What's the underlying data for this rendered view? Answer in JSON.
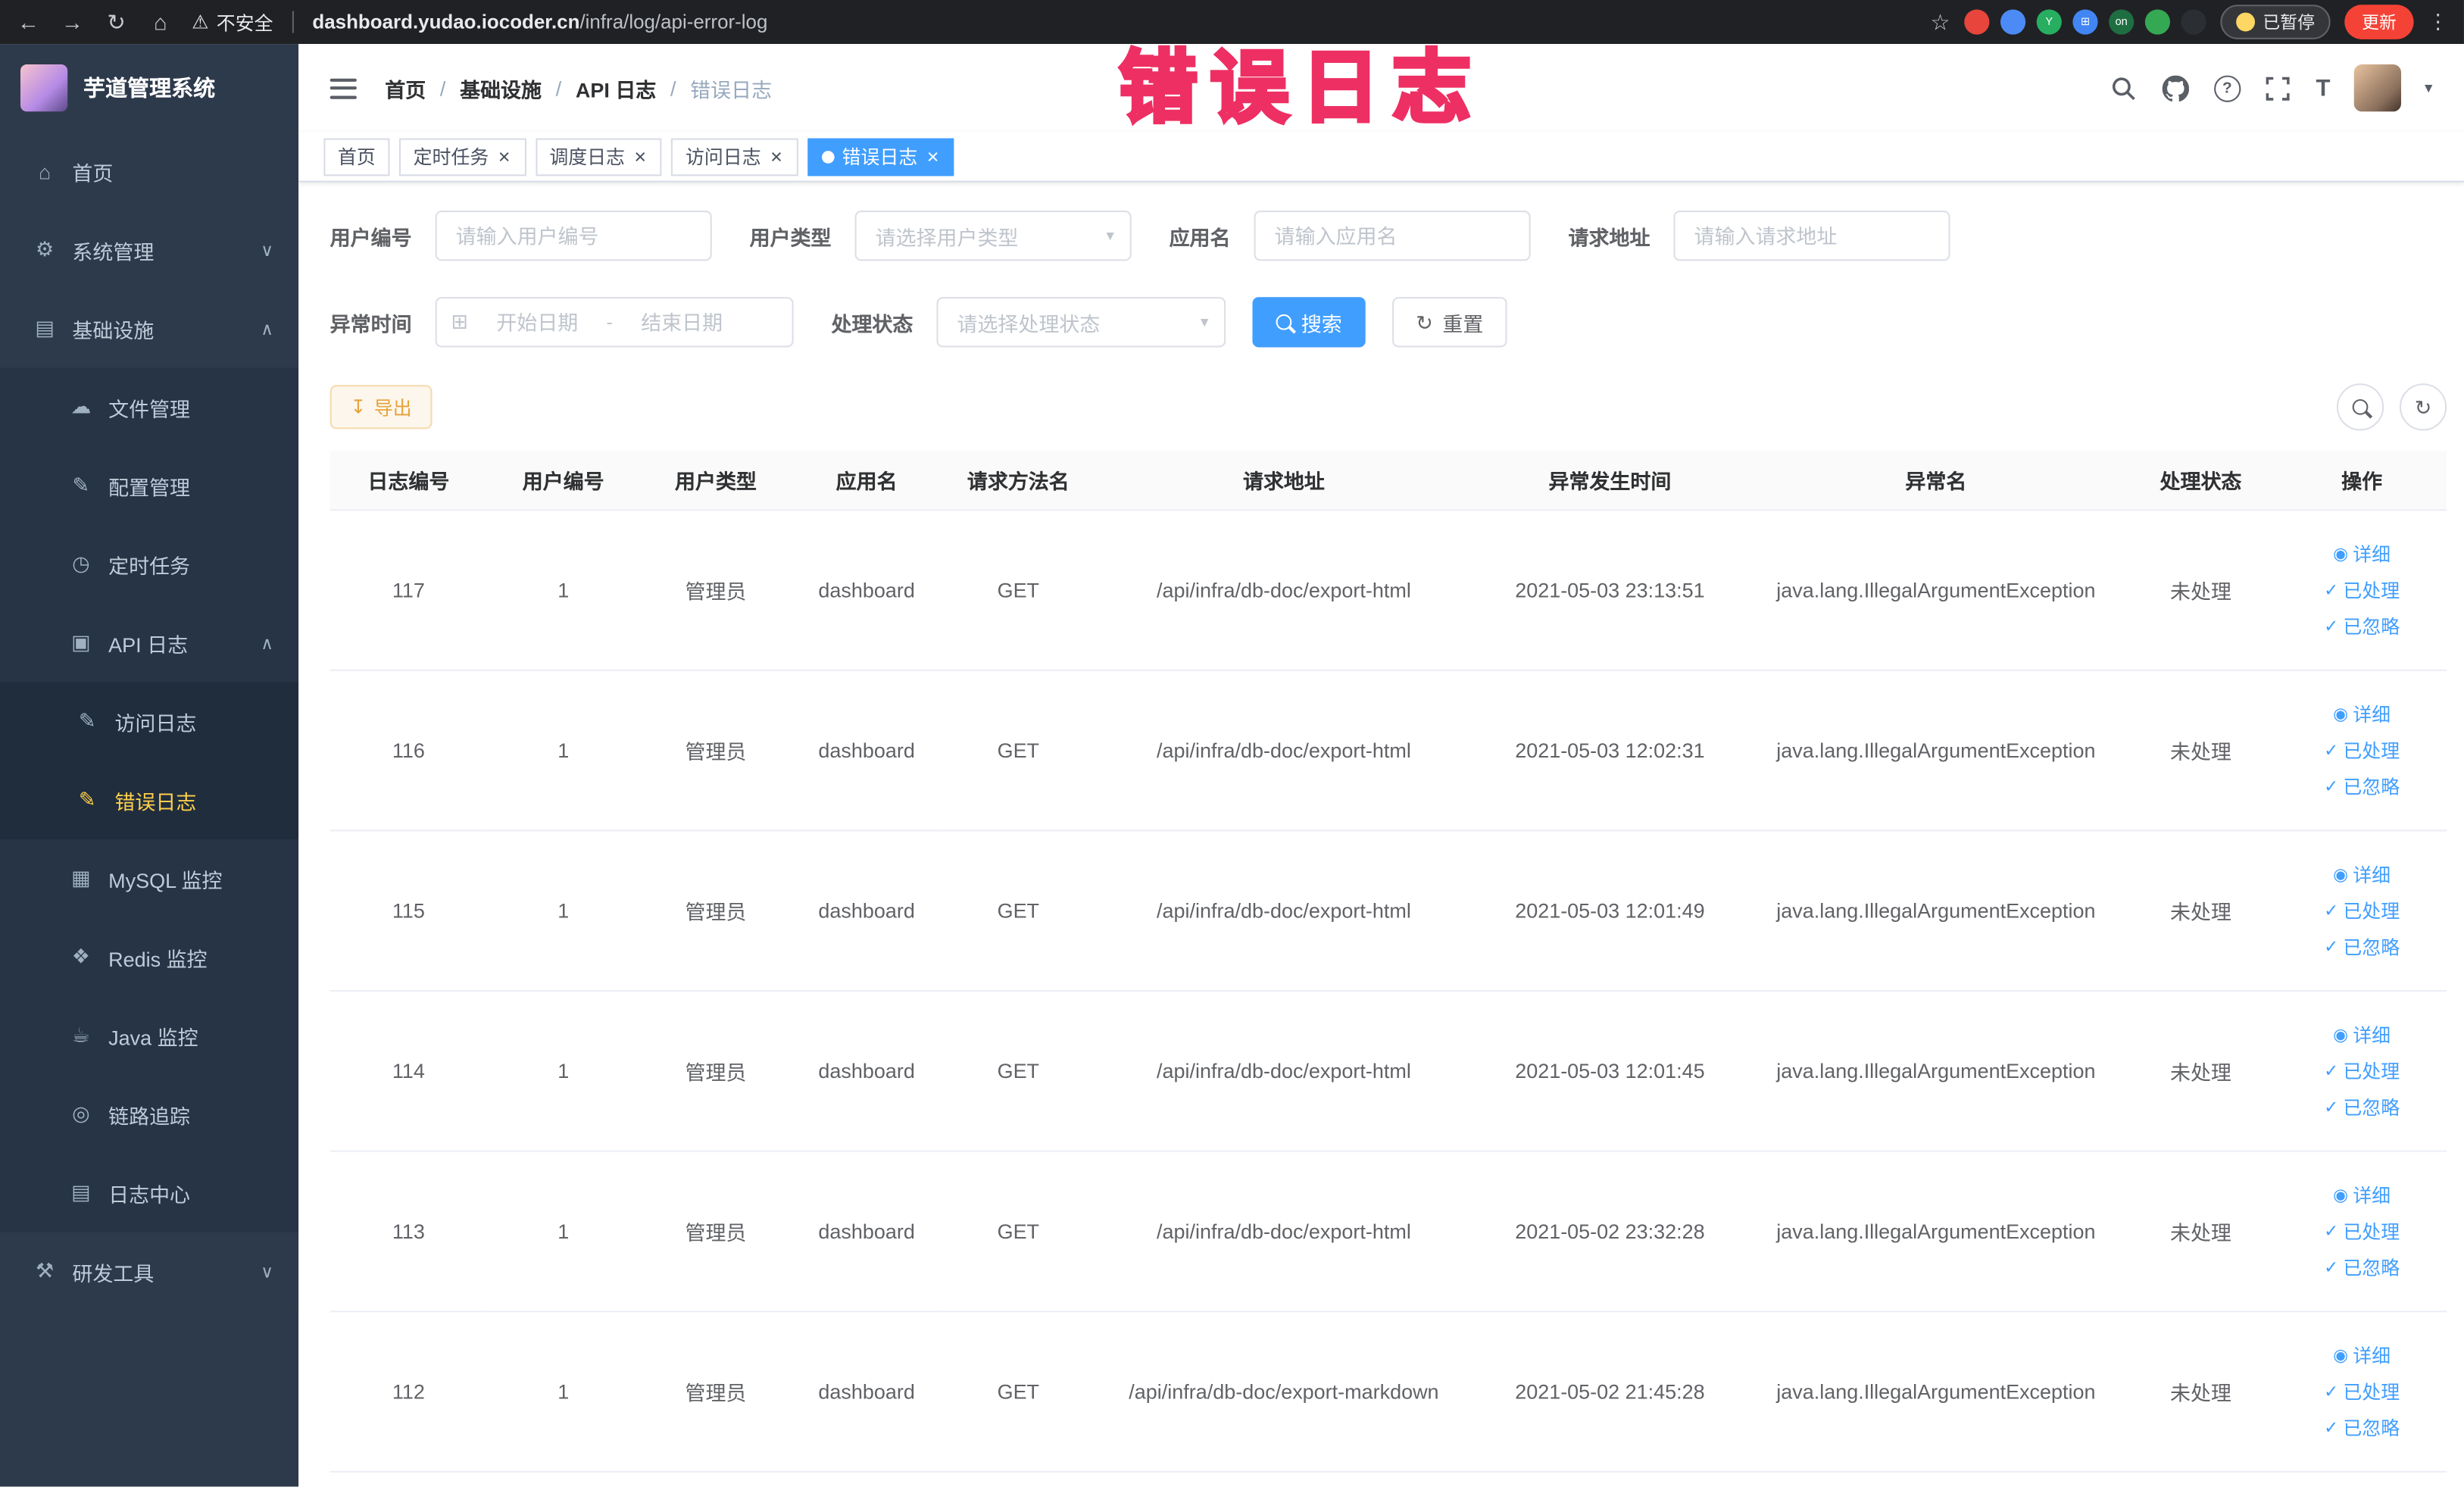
{
  "icon_glyphs": {
    "home": "⌂",
    "gear": "⚙",
    "infra": "▤",
    "file": "☁",
    "config": "✎",
    "timer": "◷",
    "api-log": "▣",
    "doc": "✎",
    "mysql": "▦",
    "redis": "❖",
    "java": "☕",
    "trace": "◎",
    "log-center": "▤",
    "tools": "⚒",
    "arrow-up": "∧",
    "arrow-down": "∨",
    "caret-down": "▾",
    "back": "←",
    "forward": "→",
    "reload": "↻",
    "warning": "⚠",
    "star": "☆",
    "kebab": "⋮",
    "eye": "◉",
    "check": "✓",
    "download": "↧",
    "refresh": "↻",
    "calendar": "⊞",
    "font-size": "T",
    "question": "?"
  },
  "browser": {
    "security_label": "不安全",
    "url_domain": "dashboard.yudao.iocoder.cn",
    "url_path": "/infra/log/api-error-log",
    "extensions": [
      {
        "color": "#e8453c",
        "label": ""
      },
      {
        "color": "#4c8bf5",
        "label": ""
      },
      {
        "color": "#27ae60",
        "label": "Y"
      },
      {
        "color": "#4285f4",
        "label": "⊞"
      },
      {
        "color": "#1e6e42",
        "label": "on"
      },
      {
        "color": "#34a853",
        "label": ""
      },
      {
        "color": "#2b2f33",
        "label": ""
      }
    ],
    "paused_label": "已暂停",
    "update_label": "更新"
  },
  "overlay": {
    "title": "错误日志"
  },
  "sidebar": {
    "logo_title": "芋道管理系统",
    "items": [
      {
        "label": "首页",
        "icon": "home",
        "depth": 0
      },
      {
        "label": "系统管理",
        "icon": "gear",
        "depth": 0,
        "arrow": "down"
      },
      {
        "label": "基础设施",
        "icon": "infra",
        "depth": 0,
        "arrow": "up"
      },
      {
        "label": "文件管理",
        "icon": "file",
        "depth": 1
      },
      {
        "label": "配置管理",
        "icon": "config",
        "depth": 1
      },
      {
        "label": "定时任务",
        "icon": "timer",
        "depth": 1
      },
      {
        "label": "API 日志",
        "icon": "api-log",
        "depth": 1,
        "arrow": "up"
      },
      {
        "label": "访问日志",
        "icon": "doc",
        "depth": 2
      },
      {
        "label": "错误日志",
        "icon": "doc",
        "depth": 2,
        "active": true
      },
      {
        "label": "MySQL 监控",
        "icon": "mysql",
        "depth": 1
      },
      {
        "label": "Redis 监控",
        "icon": "redis",
        "depth": 1
      },
      {
        "label": "Java 监控",
        "icon": "java",
        "depth": 1
      },
      {
        "label": "链路追踪",
        "icon": "trace",
        "depth": 1
      },
      {
        "label": "日志中心",
        "icon": "log-center",
        "depth": 1
      },
      {
        "label": "研发工具",
        "icon": "tools",
        "depth": 0,
        "arrow": "down"
      }
    ]
  },
  "header": {
    "separator": "/",
    "breadcrumb": [
      {
        "label": "首页"
      },
      {
        "label": "基础设施"
      },
      {
        "label": "API 日志"
      },
      {
        "label": "错误日志",
        "current": true
      }
    ]
  },
  "tabs_meta": {
    "close_glyph": "×"
  },
  "tabs": [
    {
      "label": "首页"
    },
    {
      "label": "定时任务",
      "closable": true
    },
    {
      "label": "调度日志",
      "closable": true
    },
    {
      "label": "访问日志",
      "closable": true
    },
    {
      "label": "错误日志",
      "closable": true,
      "active": true
    }
  ],
  "filters": {
    "user_id_label": "用户编号",
    "user_id_placeholder": "请输入用户编号",
    "user_type_label": "用户类型",
    "user_type_placeholder": "请选择用户类型",
    "app_label": "应用名",
    "app_placeholder": "请输入应用名",
    "url_label": "请求地址",
    "url_placeholder": "请输入请求地址",
    "time_label": "异常时间",
    "time_start_placeholder": "开始日期",
    "time_separator": "-",
    "time_end_placeholder": "结束日期",
    "status_label": "处理状态",
    "status_placeholder": "请选择处理状态",
    "search_label": "搜索",
    "reset_label": "重置"
  },
  "toolbar": {
    "export_label": "导出"
  },
  "table": {
    "columns": [
      "日志编号",
      "用户编号",
      "用户类型",
      "应用名",
      "请求方法名",
      "请求地址",
      "异常发生时间",
      "异常名",
      "处理状态",
      "操作"
    ],
    "actions": [
      "详细",
      "已处理",
      "已忽略"
    ],
    "rows": [
      {
        "id": "117",
        "user_id": "1",
        "user_type": "管理员",
        "app_name": "dashboard",
        "method": "GET",
        "url": "/api/infra/db-doc/export-html",
        "time": "2021-05-03 23:13:51",
        "exception": "java.lang.IllegalArgumentException",
        "status": "未处理"
      },
      {
        "id": "116",
        "user_id": "1",
        "user_type": "管理员",
        "app_name": "dashboard",
        "method": "GET",
        "url": "/api/infra/db-doc/export-html",
        "time": "2021-05-03 12:02:31",
        "exception": "java.lang.IllegalArgumentException",
        "status": "未处理"
      },
      {
        "id": "115",
        "user_id": "1",
        "user_type": "管理员",
        "app_name": "dashboard",
        "method": "GET",
        "url": "/api/infra/db-doc/export-html",
        "time": "2021-05-03 12:01:49",
        "exception": "java.lang.IllegalArgumentException",
        "status": "未处理"
      },
      {
        "id": "114",
        "user_id": "1",
        "user_type": "管理员",
        "app_name": "dashboard",
        "method": "GET",
        "url": "/api/infra/db-doc/export-html",
        "time": "2021-05-03 12:01:45",
        "exception": "java.lang.IllegalArgumentException",
        "status": "未处理"
      },
      {
        "id": "113",
        "user_id": "1",
        "user_type": "管理员",
        "app_name": "dashboard",
        "method": "GET",
        "url": "/api/infra/db-doc/export-html",
        "time": "2021-05-02 23:32:28",
        "exception": "java.lang.IllegalArgumentException",
        "status": "未处理"
      },
      {
        "id": "112",
        "user_id": "1",
        "user_type": "管理员",
        "app_name": "dashboard",
        "method": "GET",
        "url": "/api/infra/db-doc/export-markdown",
        "time": "2021-05-02 21:45:28",
        "exception": "java.lang.IllegalArgumentException",
        "status": "未处理"
      }
    ]
  }
}
